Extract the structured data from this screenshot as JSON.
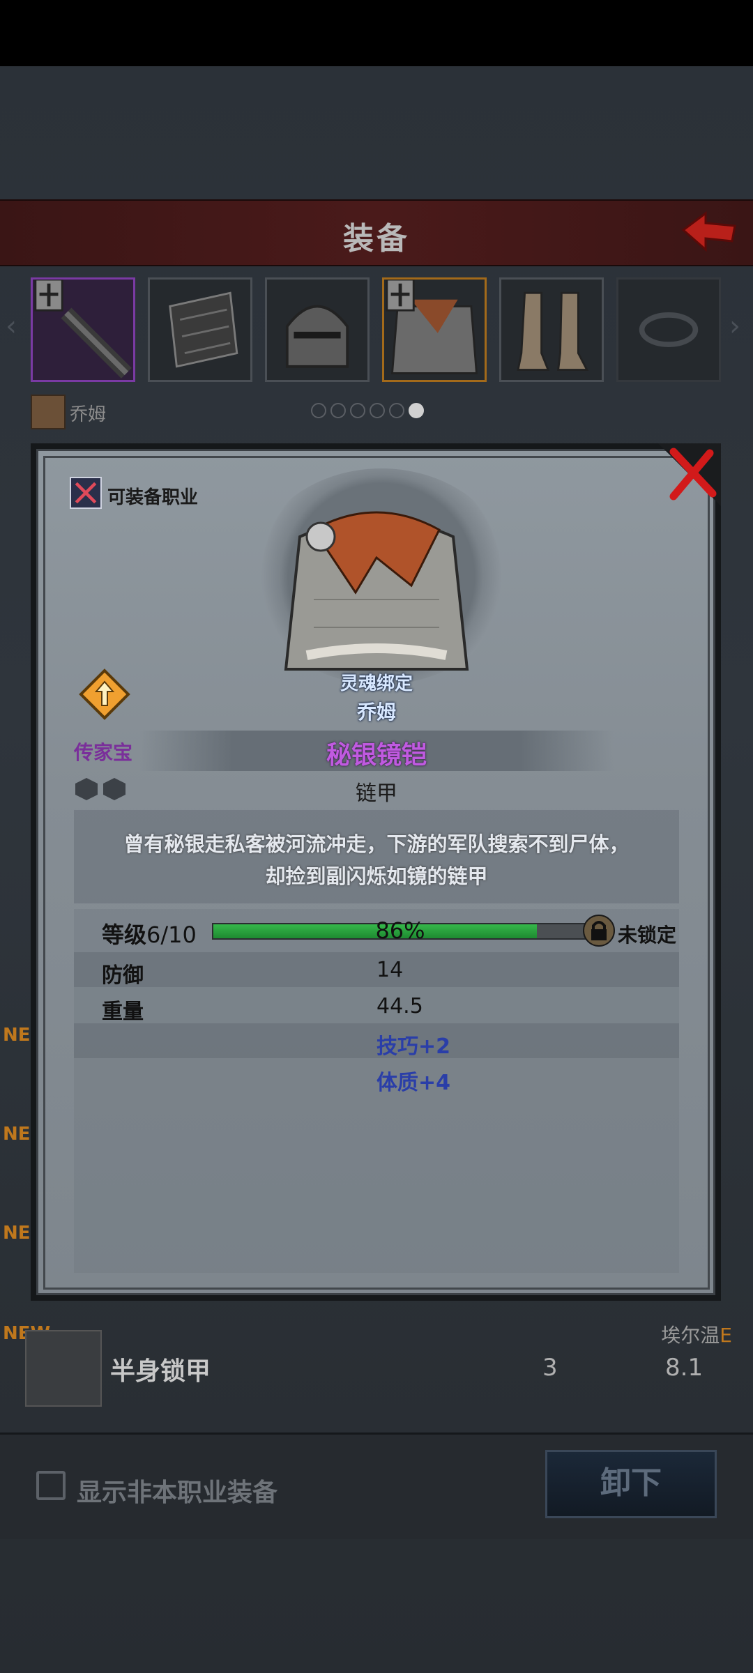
{
  "header": {
    "title": "装备"
  },
  "hero": {
    "name": "乔姆"
  },
  "page_indicator": {
    "total": 6,
    "active": 6
  },
  "list": {
    "new_badge": "NEW",
    "row": {
      "name": "半身锁甲",
      "hero": "埃尔温",
      "rank": "E",
      "value1": "3",
      "value2": "8.1"
    }
  },
  "bottom": {
    "checkbox_label": "显示非本职业装备",
    "unequip_label": "卸下"
  },
  "modal": {
    "class_label": "可装备职业",
    "soulbound": "灵魂绑定",
    "owner": "乔姆",
    "heirloom_label": "传家宝",
    "item_name": "秘银镜铠",
    "item_type": "链甲",
    "description": [
      "曾有秘银走私客被河流冲走，下游的军队搜索不到尸体，",
      "却捡到副闪烁如镜的链甲"
    ],
    "level": {
      "label": "等级",
      "value": "6/10",
      "percent_text": "86%",
      "fraction": 0.86,
      "lock_label": "未锁定"
    },
    "stats": [
      {
        "label": "防御",
        "value": "14"
      },
      {
        "label": "重量",
        "value": "44.5"
      }
    ],
    "bonuses": [
      "技巧+2",
      "体质+4"
    ]
  },
  "colors": {
    "item_name": "#c05ae0",
    "heirloom": "#7a2f9a",
    "bonus": "#2a3ea8",
    "xp_fill": "#35b84a",
    "close": "#d21a1a",
    "header": "#4a1a1a"
  }
}
